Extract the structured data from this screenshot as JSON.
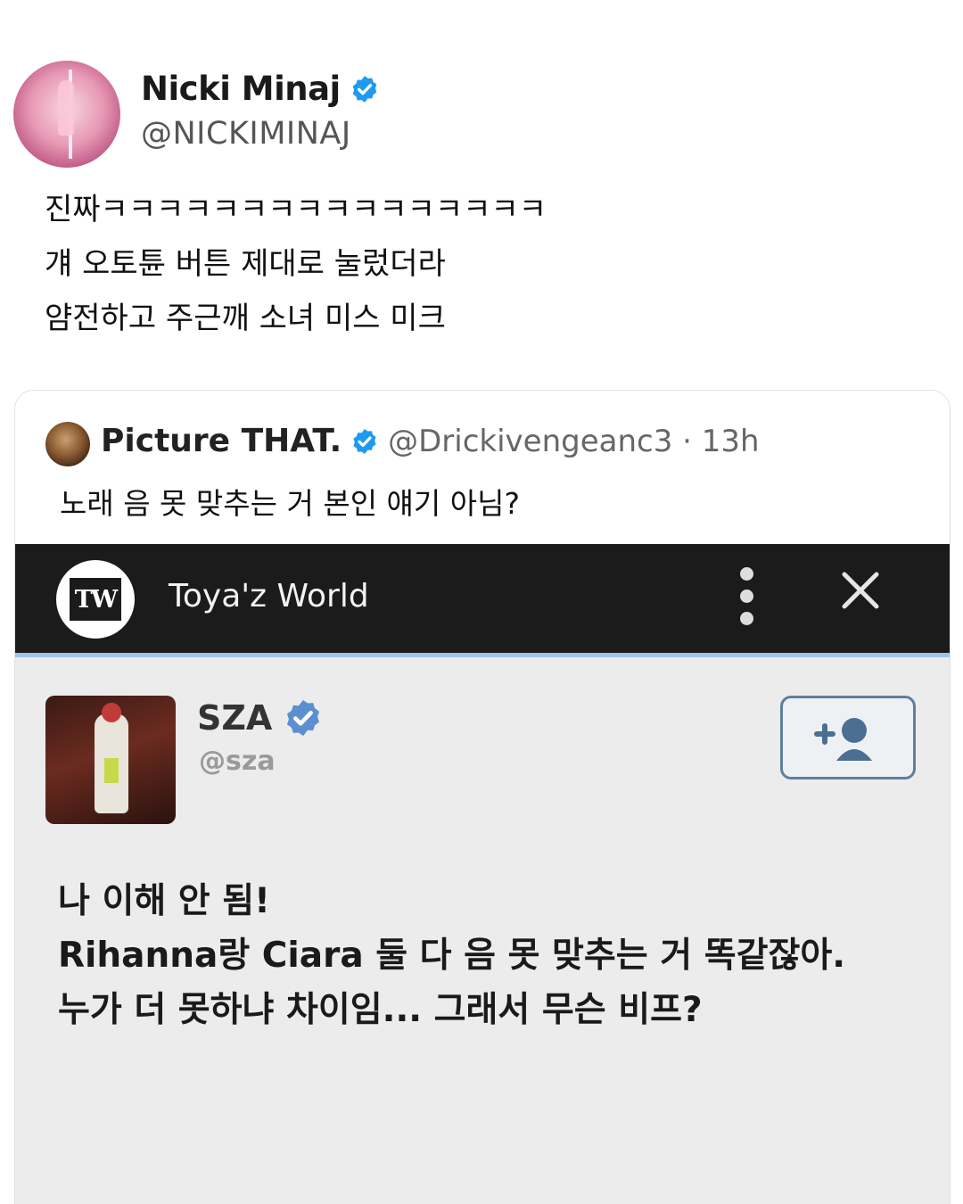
{
  "main_tweet": {
    "display_name": "Nicki Minaj",
    "handle": "@NICKIMINAJ",
    "lines": [
      "진짜ㅋㅋㅋㅋㅋㅋㅋㅋㅋㅋㅋㅋㅋㅋㅋㅋ",
      "걔 오토튠 버튼 제대로 눌렀더라",
      "얌전하고 주근깨 소녀 미스 미크"
    ],
    "icons": [
      "avatar",
      "verified-badge-icon"
    ]
  },
  "quoted_tweet": {
    "display_name": "Picture THAT.",
    "handle_time": "@Drickivengeanc3 · 13h",
    "text": "노래 음 못 맞추는 거 본인 얘기 아님?",
    "embedded": {
      "app_bar": {
        "logo_text": "TW",
        "title": "Toya'z World",
        "icons": [
          "more-vertical-icon",
          "close-icon"
        ]
      },
      "post": {
        "display_name": "SZA",
        "handle": "@sza",
        "icons": [
          "verified-badge-icon",
          "add-user-icon"
        ],
        "lines": [
          "나 이해 안 됨!",
          "Rihanna랑 Ciara 둘 다 음 못 맞추는 거 똑같잖아.",
          "누가 더 못하냐 차이임... 그래서 무슨 비프?"
        ]
      }
    }
  },
  "colors": {
    "verified_blue": "#1d9bf0",
    "app_bar_bg": "#1b1b1b",
    "app_bar_border": "#9fc2ea",
    "screenshot_bg": "#ececec"
  }
}
